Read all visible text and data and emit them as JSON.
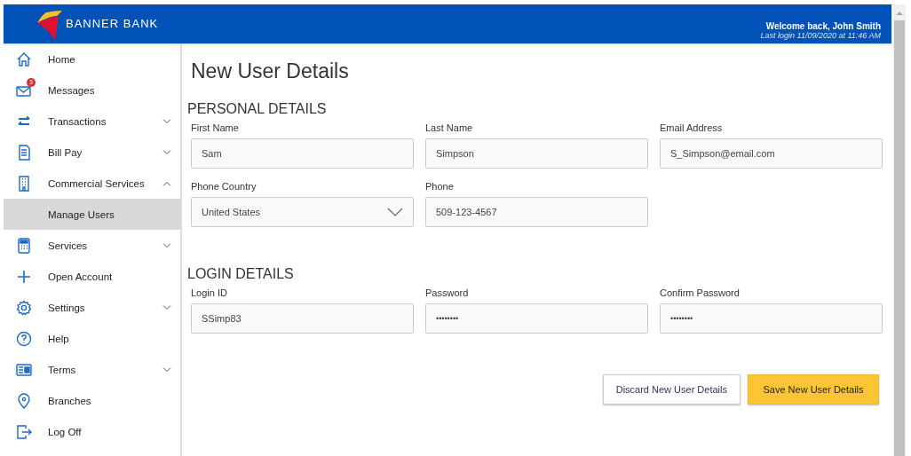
{
  "header": {
    "logo": "BANNER BANK",
    "welcome": "Welcome back, John Smith",
    "last_login": "Last login 11/09/2020 at 11:46 AM"
  },
  "sidebar": {
    "items": [
      {
        "label": "Home",
        "selected": false
      },
      {
        "label": "Messages",
        "badge": "3",
        "selected": false
      },
      {
        "label": "Transactions",
        "expanded": false,
        "selected": false
      },
      {
        "label": "Bill Pay",
        "expanded": false,
        "selected": false
      },
      {
        "label": "Commercial Services",
        "expanded": true,
        "selected": false,
        "children": [
          {
            "label": "Manage Users",
            "selected": true
          }
        ]
      },
      {
        "label": "Services",
        "expanded": false,
        "selected": false
      },
      {
        "label": "Open Account",
        "selected": false
      },
      {
        "label": "Settings",
        "expanded": false,
        "selected": false
      },
      {
        "label": "Help",
        "selected": false
      },
      {
        "label": "Terms",
        "expanded": false,
        "selected": false
      },
      {
        "label": "Branches",
        "selected": false
      },
      {
        "label": "Log Off",
        "selected": false
      }
    ]
  },
  "page_title": "New User Details",
  "sections": [
    {
      "heading": "PERSONAL DETAILS",
      "rows": [
        [
          {
            "label": "First Name",
            "value": "Sam",
            "kind": "text"
          },
          {
            "label": "Last Name",
            "value": "Simpson",
            "kind": "text"
          },
          {
            "label": "Email Address",
            "value": "S_Simpson@email.com",
            "kind": "text"
          }
        ],
        [
          {
            "label": "Phone Country",
            "value": "United States",
            "kind": "select"
          },
          {
            "label": "Phone",
            "value": "509-123-4567",
            "kind": "text"
          }
        ]
      ]
    },
    {
      "heading": "LOGIN DETAILS",
      "rows": [
        [
          {
            "label": "Login ID",
            "value": "SSimp83",
            "kind": "text"
          },
          {
            "label": "Password",
            "value": "••••••••",
            "kind": "password"
          },
          {
            "label": "Confirm Password",
            "value": "••••••••",
            "kind": "password"
          }
        ]
      ]
    }
  ],
  "buttons": [
    {
      "label": "Discard New User Details",
      "kind": "secondary"
    },
    {
      "label": "Save New User Details",
      "kind": "primary"
    }
  ]
}
